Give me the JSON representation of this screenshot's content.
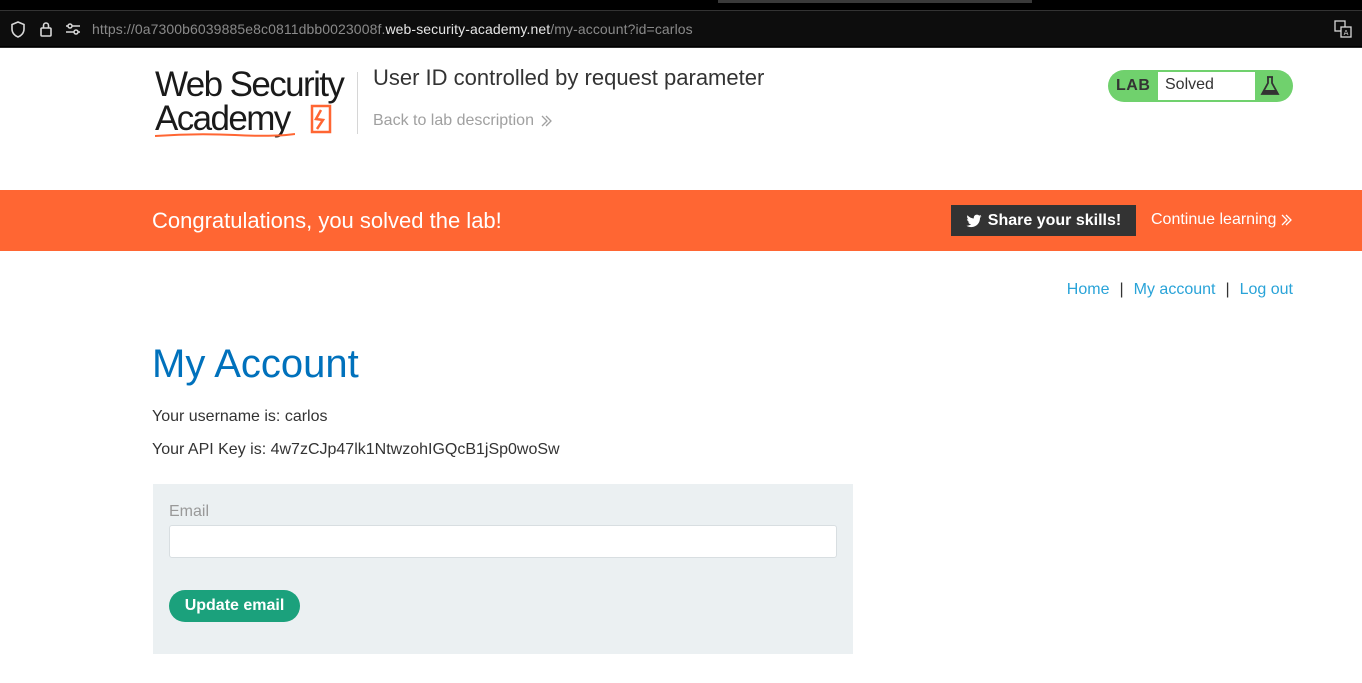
{
  "browser": {
    "url_prefix": "https://0a7300b6039885e8c0811dbb0023008f.",
    "url_host": "web-security-academy.net",
    "url_path": "/my-account?id=carlos"
  },
  "header": {
    "logo_line1": "Web Security",
    "logo_line2": "Academy",
    "lab_title": "User ID controlled by request parameter",
    "back_link": "Back to lab description"
  },
  "lab_status": {
    "tag": "LAB",
    "state": "Solved"
  },
  "banner": {
    "message": "Congratulations, you solved the lab!",
    "share_label": "Share your skills!",
    "continue_label": "Continue learning"
  },
  "nav": {
    "home": "Home",
    "account": "My account",
    "logout": "Log out",
    "separator": "|"
  },
  "main": {
    "title": "My Account",
    "username_line": "Your username is: carlos",
    "apikey_line": "Your API Key is: 4w7zCJp47lk1NtwzohIGQcB1jSp0woSw"
  },
  "form": {
    "email_label": "Email",
    "email_value": "",
    "submit_label": "Update email"
  },
  "colors": {
    "banner": "#ff6633",
    "title_blue": "#0071bc",
    "link_blue": "#29a3d8",
    "lab_green": "#70d16d",
    "button_green": "#1ba17c",
    "panel": "#ebf0f2"
  }
}
